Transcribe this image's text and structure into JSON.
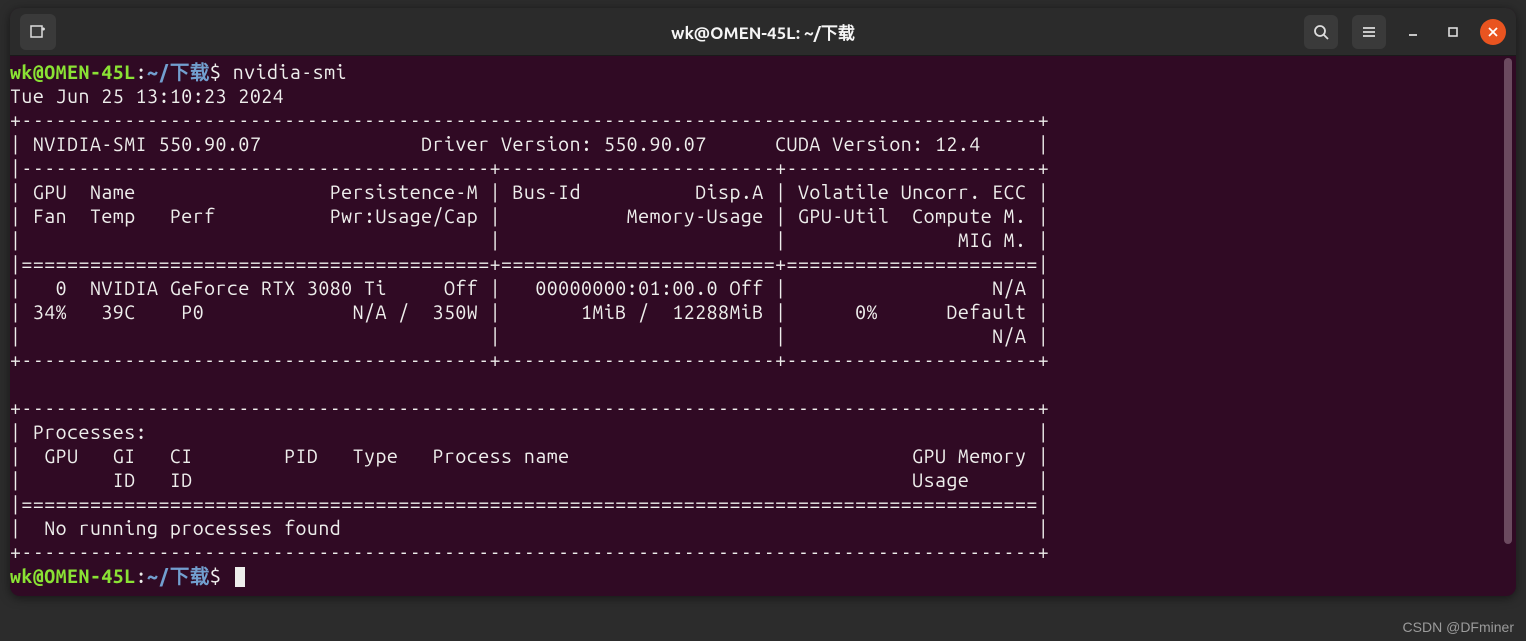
{
  "titlebar": {
    "title": "wk@OMEN-45L: ~/下载"
  },
  "prompt": {
    "user": "wk@OMEN-45L",
    "sep": ":",
    "path": "~/下载",
    "dollar": "$",
    "command": "nvidia-smi"
  },
  "output": {
    "timestamp": "Tue Jun 25 13:10:23 2024",
    "top_border": "+-----------------------------------------------------------------------------------------+",
    "header_line": "| NVIDIA-SMI 550.90.07              Driver Version: 550.90.07      CUDA Version: 12.4     |",
    "sep1": "|-----------------------------------------+------------------------+----------------------+",
    "col_h1": "| GPU  Name                 Persistence-M | Bus-Id          Disp.A | Volatile Uncorr. ECC |",
    "col_h2": "| Fan  Temp   Perf          Pwr:Usage/Cap |           Memory-Usage | GPU-Util  Compute M. |",
    "col_h3": "|                                         |                        |               MIG M. |",
    "sep2": "|=========================================+========================+======================|",
    "gpu_l1": "|   0  NVIDIA GeForce RTX 3080 Ti     Off |   00000000:01:00.0 Off |                  N/A |",
    "gpu_l2": "| 34%   39C    P0             N/A /  350W |       1MiB /  12288MiB |      0%      Default |",
    "gpu_l3": "|                                         |                        |                  N/A |",
    "bot_border": "+-----------------------------------------+------------------------+----------------------+",
    "blank": "                                                                                         ",
    "proc_top": "+-----------------------------------------------------------------------------------------+",
    "proc_h1": "| Processes:                                                                              |",
    "proc_h2": "|  GPU   GI   CI        PID   Type   Process name                              GPU Memory |",
    "proc_h3": "|        ID   ID                                                               Usage      |",
    "proc_sep": "|=========================================================================================|",
    "proc_none": "|  No running processes found                                                             |",
    "proc_bot": "+-----------------------------------------------------------------------------------------+"
  },
  "watermark": "CSDN @DFminer"
}
